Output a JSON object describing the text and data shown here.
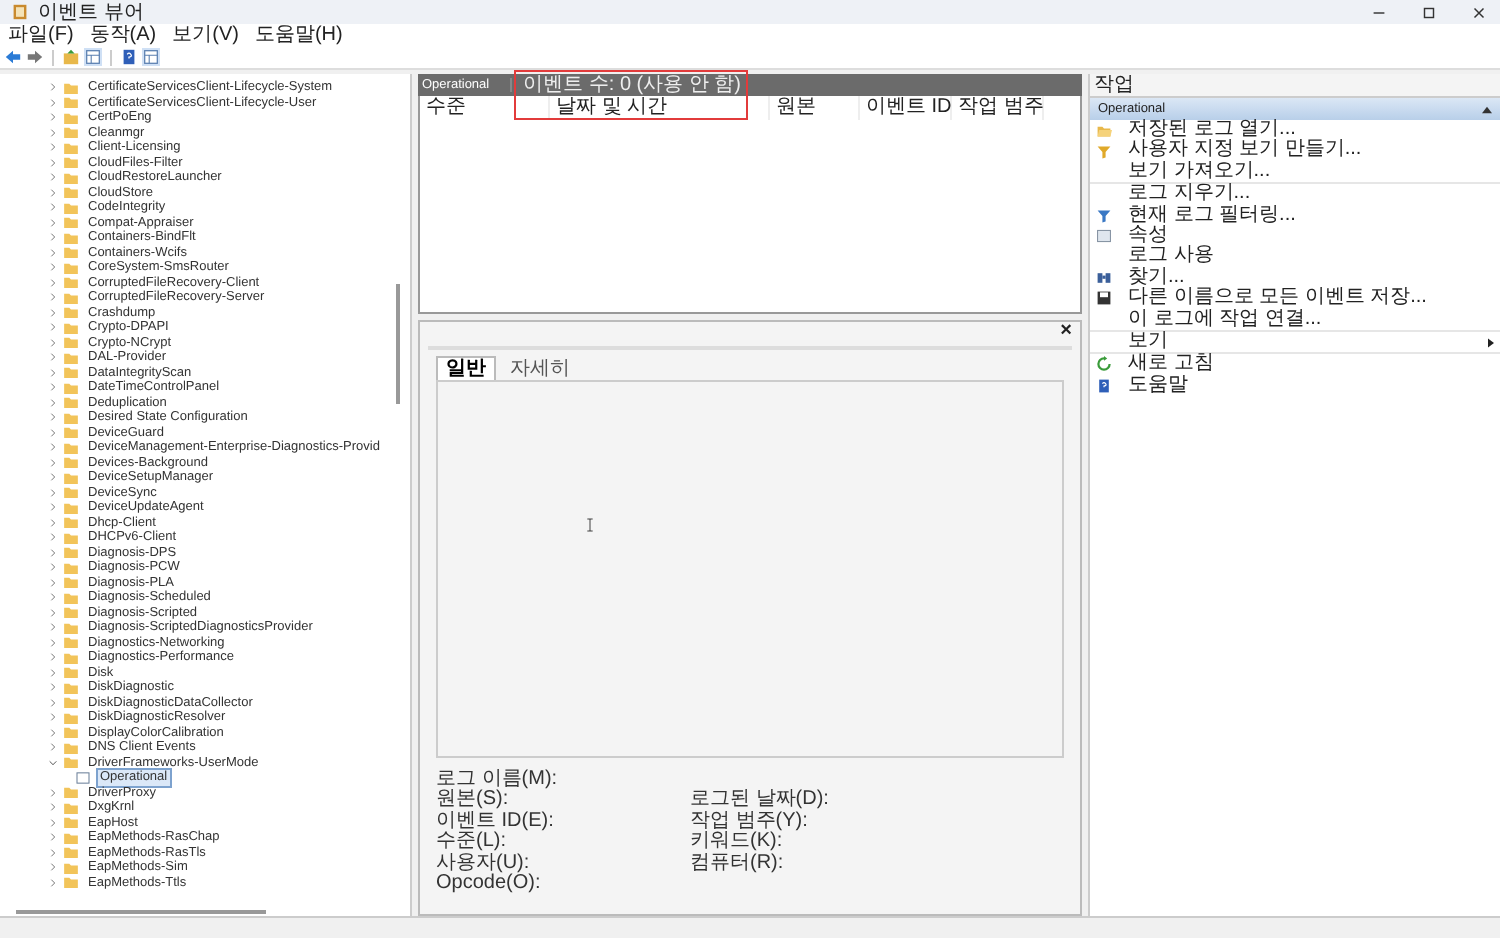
{
  "window": {
    "title": "이벤트 뷰어"
  },
  "menu": [
    "파일(F)",
    "동작(A)",
    "보기(V)",
    "도움말(H)"
  ],
  "tree": [
    {
      "label": "CertificateServicesClient-Lifecycle-System",
      "expanded": false,
      "selected": false
    },
    {
      "label": "CertificateServicesClient-Lifecycle-User",
      "expanded": false,
      "selected": false
    },
    {
      "label": "CertPoEng",
      "expanded": false,
      "selected": false
    },
    {
      "label": "Cleanmgr",
      "expanded": false,
      "selected": false
    },
    {
      "label": "Client-Licensing",
      "expanded": false,
      "selected": false
    },
    {
      "label": "CloudFiles-Filter",
      "expanded": false,
      "selected": false
    },
    {
      "label": "CloudRestoreLauncher",
      "expanded": false,
      "selected": false
    },
    {
      "label": "CloudStore",
      "expanded": false,
      "selected": false
    },
    {
      "label": "CodeIntegrity",
      "expanded": false,
      "selected": false
    },
    {
      "label": "Compat-Appraiser",
      "expanded": false,
      "selected": false
    },
    {
      "label": "Containers-BindFlt",
      "expanded": false,
      "selected": false
    },
    {
      "label": "Containers-Wcifs",
      "expanded": false,
      "selected": false
    },
    {
      "label": "CoreSystem-SmsRouter",
      "expanded": false,
      "selected": false
    },
    {
      "label": "CorruptedFileRecovery-Client",
      "expanded": false,
      "selected": false
    },
    {
      "label": "CorruptedFileRecovery-Server",
      "expanded": false,
      "selected": false
    },
    {
      "label": "Crashdump",
      "expanded": false,
      "selected": false
    },
    {
      "label": "Crypto-DPAPI",
      "expanded": false,
      "selected": false
    },
    {
      "label": "Crypto-NCrypt",
      "expanded": false,
      "selected": false
    },
    {
      "label": "DAL-Provider",
      "expanded": false,
      "selected": false
    },
    {
      "label": "DataIntegrityScan",
      "expanded": false,
      "selected": false
    },
    {
      "label": "DateTimeControlPanel",
      "expanded": false,
      "selected": false
    },
    {
      "label": "Deduplication",
      "expanded": false,
      "selected": false
    },
    {
      "label": "Desired State Configuration",
      "expanded": false,
      "selected": false
    },
    {
      "label": "DeviceGuard",
      "expanded": false,
      "selected": false
    },
    {
      "label": "DeviceManagement-Enterprise-Diagnostics-Provid",
      "expanded": false,
      "selected": false
    },
    {
      "label": "Devices-Background",
      "expanded": false,
      "selected": false
    },
    {
      "label": "DeviceSetupManager",
      "expanded": false,
      "selected": false
    },
    {
      "label": "DeviceSync",
      "expanded": false,
      "selected": false
    },
    {
      "label": "DeviceUpdateAgent",
      "expanded": false,
      "selected": false
    },
    {
      "label": "Dhcp-Client",
      "expanded": false,
      "selected": false
    },
    {
      "label": "DHCPv6-Client",
      "expanded": false,
      "selected": false
    },
    {
      "label": "Diagnosis-DPS",
      "expanded": false,
      "selected": false
    },
    {
      "label": "Diagnosis-PCW",
      "expanded": false,
      "selected": false
    },
    {
      "label": "Diagnosis-PLA",
      "expanded": false,
      "selected": false
    },
    {
      "label": "Diagnosis-Scheduled",
      "expanded": false,
      "selected": false
    },
    {
      "label": "Diagnosis-Scripted",
      "expanded": false,
      "selected": false
    },
    {
      "label": "Diagnosis-ScriptedDiagnosticsProvider",
      "expanded": false,
      "selected": false
    },
    {
      "label": "Diagnostics-Networking",
      "expanded": false,
      "selected": false
    },
    {
      "label": "Diagnostics-Performance",
      "expanded": false,
      "selected": false
    },
    {
      "label": "Disk",
      "expanded": false,
      "selected": false
    },
    {
      "label": "DiskDiagnostic",
      "expanded": false,
      "selected": false
    },
    {
      "label": "DiskDiagnosticDataCollector",
      "expanded": false,
      "selected": false
    },
    {
      "label": "DiskDiagnosticResolver",
      "expanded": false,
      "selected": false
    },
    {
      "label": "DisplayColorCalibration",
      "expanded": false,
      "selected": false
    },
    {
      "label": "DNS Client Events",
      "expanded": false,
      "selected": false
    },
    {
      "label": "DriverFrameworks-UserMode",
      "expanded": true,
      "selected": false,
      "children": [
        {
          "label": "Operational",
          "selected": true
        }
      ]
    },
    {
      "label": "DriverProxy",
      "expanded": false,
      "selected": false
    },
    {
      "label": "DxgKrnl",
      "expanded": false,
      "selected": false
    },
    {
      "label": "EapHost",
      "expanded": false,
      "selected": false
    },
    {
      "label": "EapMethods-RasChap",
      "expanded": false,
      "selected": false
    },
    {
      "label": "EapMethods-RasTls",
      "expanded": false,
      "selected": false
    },
    {
      "label": "EapMethods-Sim",
      "expanded": false,
      "selected": false
    },
    {
      "label": "EapMethods-Ttls",
      "expanded": false,
      "selected": false
    }
  ],
  "log_header": {
    "name": "Operational",
    "event_count": "이벤트 수: 0 (사용 안 함)",
    "highlighted": true
  },
  "table": {
    "columns": [
      {
        "label": "수준"
      },
      {
        "label": "날짜 및 시간"
      },
      {
        "label": "원본"
      },
      {
        "label": "이벤트 ID"
      },
      {
        "label": "작업 범주"
      }
    ]
  },
  "detail": {
    "close": "×",
    "tabs": [
      {
        "label": "일반",
        "selected": true
      },
      {
        "label": "자세히",
        "selected": false
      }
    ],
    "fields_left": [
      "로그 이름(M):",
      "원본(S):",
      "이벤트 ID(E):",
      "수준(L):",
      "사용자(U):",
      "Opcode(O):"
    ],
    "fields_right": [
      "로그된 날짜(D):",
      "작업 범주(Y):",
      "키워드(K):",
      "컴퓨터(R):"
    ]
  },
  "actions": {
    "title": "작업",
    "section": "Operational",
    "items": [
      {
        "label": "저장된 로그 열기...",
        "kind": "folder",
        "divider": false,
        "submenu": false
      },
      {
        "label": "사용자 지정 보기 만들기...",
        "kind": "filter",
        "divider": false,
        "submenu": false
      },
      {
        "label": "보기 가져오기...",
        "divider": true,
        "submenu": false
      },
      {
        "label": "로그 지우기...",
        "divider": false,
        "submenu": false
      },
      {
        "label": "현재 로그 필터링...",
        "kind": "filter-blue",
        "divider": false,
        "submenu": false
      },
      {
        "label": "속성",
        "kind": "properties",
        "divider": false,
        "submenu": false
      },
      {
        "label": "로그 사용",
        "divider": false,
        "submenu": false
      },
      {
        "label": "찾기...",
        "kind": "binoculars",
        "divider": false,
        "submenu": false
      },
      {
        "label": "다른 이름으로 모든 이벤트 저장...",
        "kind": "disk",
        "divider": false,
        "submenu": false
      },
      {
        "label": "이 로그에 작업 연결...",
        "divider": true,
        "submenu": false
      },
      {
        "label": "보기",
        "divider": true,
        "submenu": true
      },
      {
        "label": "새로 고침",
        "kind": "refresh",
        "divider": false,
        "submenu": false
      },
      {
        "label": "도움말",
        "kind": "help",
        "divider": false,
        "submenu": false
      }
    ]
  }
}
